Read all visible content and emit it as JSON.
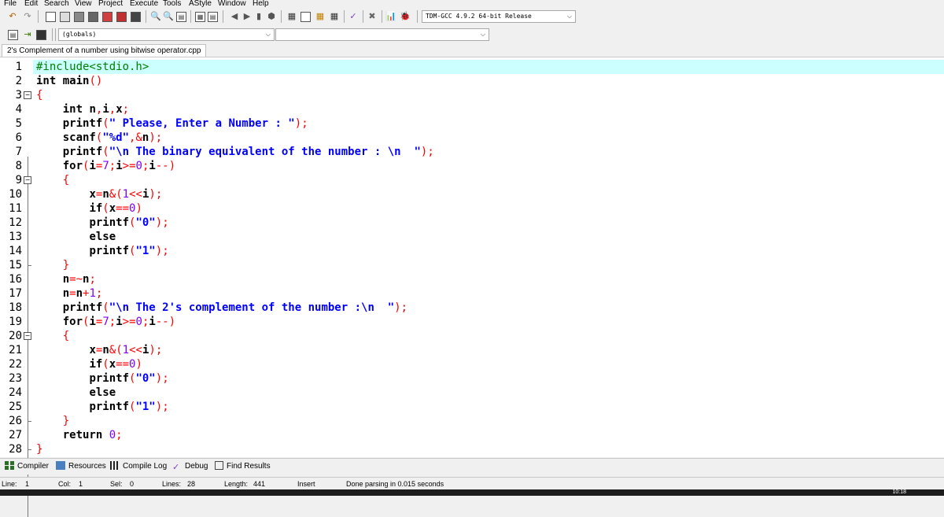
{
  "menu": [
    "File",
    "Edit",
    "Search",
    "View",
    "Project",
    "Execute",
    "Tools",
    "AStyle",
    "Window",
    "Help"
  ],
  "toolbar": {
    "compiler_select": "TDM-GCC 4.9.2 64-bit Release",
    "scope_select": "(globals)"
  },
  "file_tab": "2's Complement of a number using bitwise operator.cpp",
  "code_lines": [
    "#include<stdio.h>",
    "int main()",
    "{",
    "    int n,i,x;",
    "    printf(\" Please, Enter a Number : \");",
    "    scanf(\"%d\",&n);",
    "    printf(\"\\n The binary equivalent of the number : \\n  \");",
    "    for(i=7;i>=0;i--)",
    "    {",
    "        x=n&(1<<i);",
    "        if(x==0)",
    "        printf(\"0\");",
    "        else",
    "        printf(\"1\");",
    "    }",
    "    n=~n;",
    "    n=n+1;",
    "    printf(\"\\n The 2's complement of the number :\\n  \");",
    "    for(i=7;i>=0;i--)",
    "    {",
    "        x=n&(1<<i);",
    "        if(x==0)",
    "        printf(\"0\");",
    "        else",
    "        printf(\"1\");",
    "    }",
    "    return 0;",
    "}"
  ],
  "line_numbers": [
    "1",
    "2",
    "3",
    "4",
    "5",
    "6",
    "7",
    "8",
    "9",
    "10",
    "11",
    "12",
    "13",
    "14",
    "15",
    "16",
    "17",
    "18",
    "19",
    "20",
    "21",
    "22",
    "23",
    "24",
    "25",
    "26",
    "27",
    "28"
  ],
  "bottom_tabs": [
    "Compiler",
    "Resources",
    "Compile Log",
    "Debug",
    "Find Results"
  ],
  "status": {
    "line_label": "Line:",
    "line_value": "1",
    "col_label": "Col:",
    "col_value": "1",
    "sel_label": "Sel:",
    "sel_value": "0",
    "lines_label": "Lines:",
    "lines_value": "28",
    "length_label": "Length:",
    "length_value": "441",
    "mode": "Insert",
    "message": "Done parsing in 0.015 seconds"
  },
  "taskbar_clock": "10:18",
  "colors": {
    "active_line": "#ccffff",
    "string": "#0000ff",
    "number": "#8000ff",
    "symbol": "#ff0000",
    "preprocessor": "#008000"
  }
}
